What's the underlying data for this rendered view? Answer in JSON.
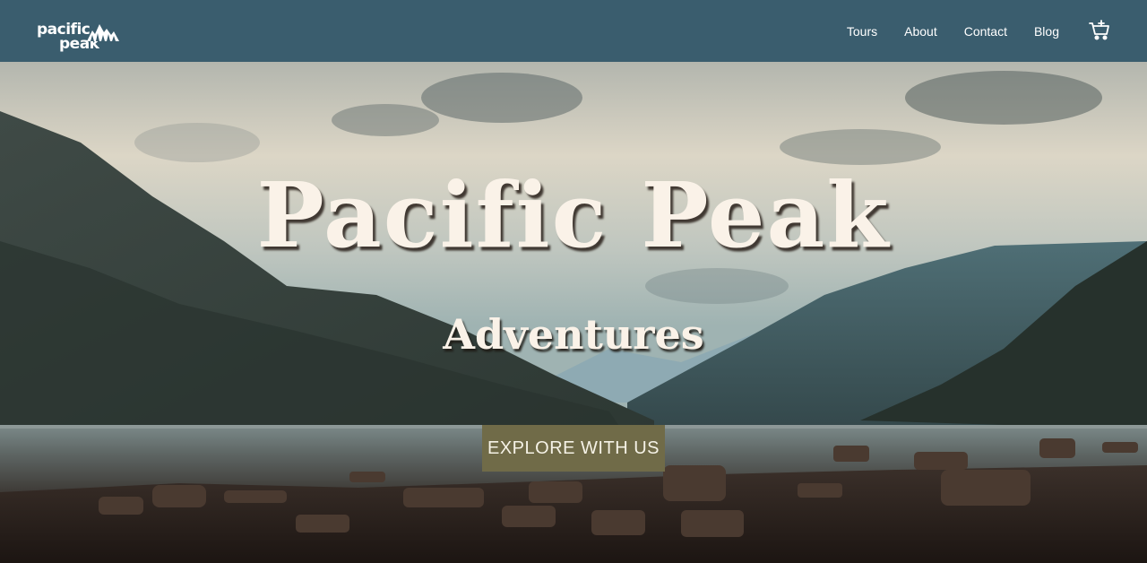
{
  "header": {
    "logo": {
      "line1": "pacific",
      "line2": "peak"
    },
    "nav": [
      {
        "label": "Tours"
      },
      {
        "label": "About"
      },
      {
        "label": "Contact"
      },
      {
        "label": "Blog"
      }
    ],
    "cart_icon": "shopping-cart-icon",
    "background_color": "#3a5d6e"
  },
  "hero": {
    "title": "Pacific Peak",
    "subtitle": "Adventures",
    "cta_label": "EXPLORE WITH US",
    "cta_color": "#706b48",
    "text_color": "#faf2e8"
  }
}
